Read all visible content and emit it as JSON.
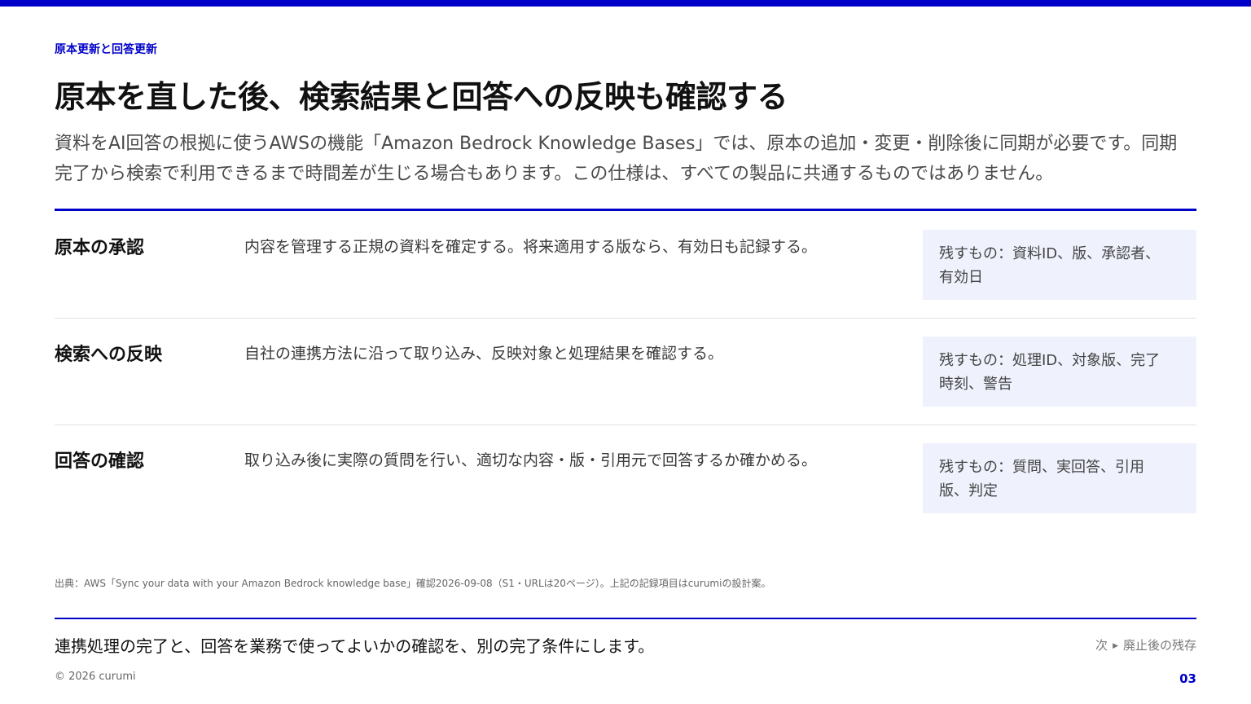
{
  "header": {
    "eyebrow": "原本更新と回答更新",
    "title": "原本を直した後、検索結果と回答への反映も確認する",
    "lead": "資料をAI回答の根拠に使うAWSの機能「Amazon Bedrock Knowledge Bases」では、原本の追加・変更・削除後に同期が必要です。同期完了から検索で利用できるまで時間差が生じる場合もあります。この仕様は、すべての製品に共通するものではありません。"
  },
  "rows": [
    {
      "title": "原本の承認",
      "description": "内容を管理する正規の資料を確定する。将来適用する版なら、有効日も記録する。",
      "note_line1": "残すもの：資料ID、版、承認者、",
      "note_line2": "有効日"
    },
    {
      "title": "検索への反映",
      "description": "自社の連携方法に沿って取り込み、反映対象と処理結果を確認する。",
      "note_line1": "残すもの：処理ID、対象版、完了",
      "note_line2": "時刻、警告"
    },
    {
      "title": "回答の確認",
      "description": "取り込み後に実際の質問を行い、適切な内容・版・引用元で回答するか確かめる。",
      "note_line1": "残すもの：質問、実回答、引用",
      "note_line2": "版、判定"
    }
  ],
  "footer": {
    "source": "出典：AWS「Sync your data with your Amazon Bedrock knowledge base」確認2026-09-08（S1・URLは20ページ）。上記の記録項目はcurumiの設計案。",
    "takeaway": "連携処理の完了と、回答を業務で使ってよいかの確認を、別の完了条件にします。",
    "next_prefix": "次",
    "next_icon": "▶",
    "next_label": "廃止後の残存",
    "copyright": "© 2026 curumi",
    "page_number": "03"
  },
  "colors": {
    "accent": "#0000c8",
    "note_background": "#eff2fd"
  }
}
